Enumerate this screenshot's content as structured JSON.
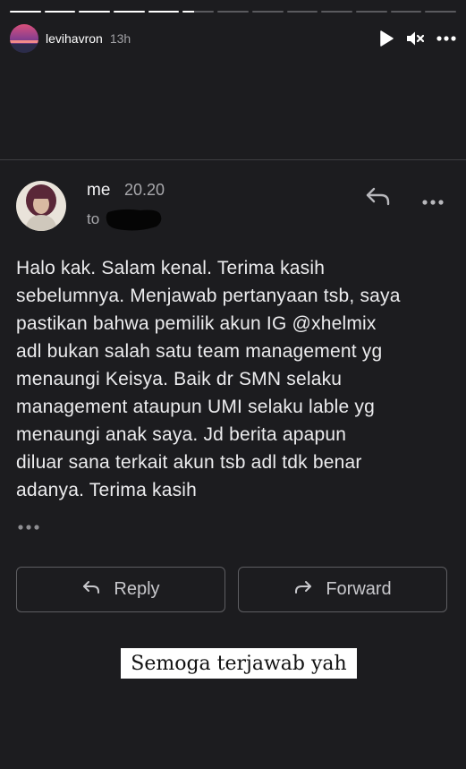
{
  "story": {
    "progress_segments": [
      1,
      1,
      1,
      1,
      1,
      0.35,
      0,
      0,
      0,
      0,
      0,
      0,
      0
    ],
    "username": "levihavron",
    "time_ago": "13h",
    "icons": {
      "play": "play-icon",
      "mute": "mute-icon",
      "more": "more-icon"
    }
  },
  "email": {
    "sender": "me",
    "time": "20.20",
    "to_label": "to",
    "body": "Halo kak. Salam kenal. Terima kasih\nsebelumnya. Menjawab pertanyaan tsb, saya\npastikan bahwa pemilik akun IG @xhelmix\nadl bukan salah satu team management yg\nmenaungi Keisya. Baik dr SMN selaku\nmanagement  ataupun UMI selaku lable yg\nmenaungi anak saya. Jd berita apapun\ndiluar sana terkait akun tsb adl tdk benar\nadanya. Terima kasih",
    "reply_button": "Reply",
    "forward_button": "Forward"
  },
  "sticker": {
    "text": "Semoga terjawab yah"
  }
}
